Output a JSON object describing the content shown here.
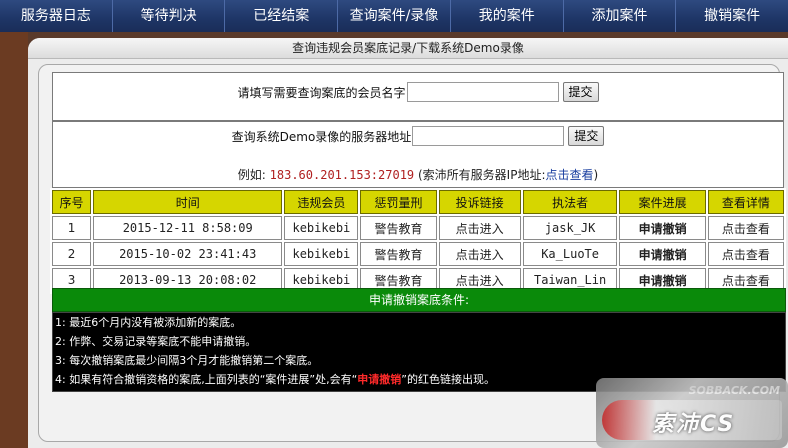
{
  "nav": [
    "服务器日志",
    "等待判决",
    "已经结案",
    "查询案件/录像",
    "我的案件",
    "添加案件",
    "撤销案件"
  ],
  "frame_title": "查询违规会员案底记录/下载系统Demo录像",
  "query_member": {
    "label": "请填写需要查询案底的会员名字",
    "button": "提交"
  },
  "query_demo": {
    "label": "查询系统Demo录像的服务器地址",
    "button": "提交",
    "example_prefix": "例如:",
    "example_ip": "183.60.201.153:27019",
    "example_note": "(索沛所有服务器IP地址:",
    "example_link": "点击查看",
    "example_close": ")"
  },
  "table": {
    "headers": [
      "序号",
      "时间",
      "违规会员",
      "惩罚量刑",
      "投诉链接",
      "执法者",
      "案件进展",
      "查看详情"
    ],
    "rows": [
      [
        "1",
        "2015-12-11  8:58:09",
        "kebikebi",
        "警告教育",
        "点击进入",
        "jask_JK",
        "申请撤销",
        "点击查看"
      ],
      [
        "2",
        "2015-10-02 23:41:43",
        "kebikebi",
        "警告教育",
        "点击进入",
        "Ka_LuoTe",
        "申请撤销",
        "点击查看"
      ],
      [
        "3",
        "2013-09-13 20:08:02",
        "kebikebi",
        "警告教育",
        "点击进入",
        "Taiwan_Lin",
        "申请撤销",
        "点击查看"
      ]
    ]
  },
  "conditions": {
    "header": "申请撤销案底条件:",
    "line1": "1: 最近6个月内没有被添加新的案底。",
    "line2": "2: 作弊、交易记录等案底不能申请撤销。",
    "line3": "3: 每次撤销案底最少间隔3个月才能撤销第二个案底。",
    "line4_a": "4: 如果有符合撤销资格的案底,上面列表的“案件进展”处,会有“",
    "line4_b": "申请撤销",
    "line4_c": "”的红色链接出现。"
  },
  "watermark": {
    "top": "SOBBACK.COM",
    "logo": "索沛CS"
  }
}
